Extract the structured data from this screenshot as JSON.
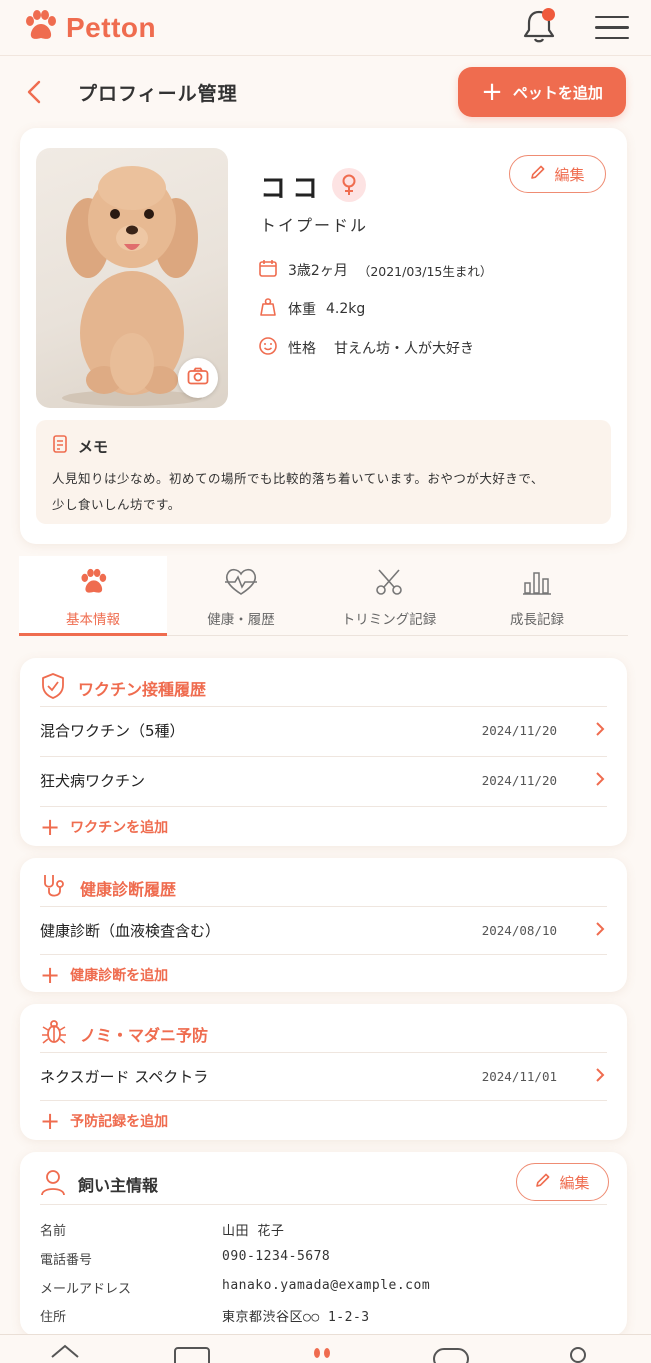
{
  "app": {
    "name": "Petton"
  },
  "header": {
    "title": "プロフィール管理",
    "add_pet_label": "ペットを追加"
  },
  "profile": {
    "name": "ココ",
    "breed": "トイプードル",
    "edit_label": "編集",
    "age": "3歳2ヶ月",
    "birthday": "（2021/03/15生まれ）",
    "weight_label": "体重",
    "weight_value": "4.2kg",
    "personality_label": "性格",
    "personality_value": "甘えん坊・人が大好き",
    "memo_title": "メモ",
    "memo_text_1": "人見知りは少なめ。初めての場所でも比較的落ち着いています。おやつが大好きで、",
    "memo_text_2": "少し食いしん坊です。"
  },
  "tabs": [
    {
      "label": "基本情報",
      "icon": "paw-icon",
      "active": true
    },
    {
      "label": "健康・履歴",
      "icon": "heart-pulse-icon",
      "active": false
    },
    {
      "label": "トリミング記録",
      "icon": "scissors-icon",
      "active": false
    },
    {
      "label": "成長記録",
      "icon": "bar-chart-icon",
      "active": false
    }
  ],
  "vaccine": {
    "title": "ワクチン接種履歴",
    "rows": [
      {
        "name": "混合ワクチン（5種）",
        "date": "2024/11/20"
      },
      {
        "name": "狂犬病ワクチン",
        "date": "2024/11/20"
      }
    ],
    "add_label": "ワクチンを追加"
  },
  "checkup": {
    "title": "健康診断履歴",
    "rows": [
      {
        "name": "健康診断（血液検査含む）",
        "date": "2024/08/10"
      }
    ],
    "add_label": "健康診断を追加"
  },
  "flea": {
    "title": "ノミ・マダニ予防",
    "rows": [
      {
        "name": "ネクスガード スペクトラ",
        "date": "2024/11/01"
      }
    ],
    "add_label": "予防記録を追加"
  },
  "owner": {
    "title": "飼い主情報",
    "edit_label": "編集",
    "fields": [
      {
        "key": "名前",
        "value": "山田 花子"
      },
      {
        "key": "電話番号",
        "value": "090-1234-5678"
      },
      {
        "key": "メールアドレス",
        "value": "hanako.yamada@example.com"
      },
      {
        "key": "住所",
        "value": "東京都渋谷区○○ 1-2-3"
      }
    ]
  },
  "colors": {
    "accent": "#ef6c4f",
    "background": "#fdf8f4",
    "memo_bg": "#fbf3ec"
  }
}
